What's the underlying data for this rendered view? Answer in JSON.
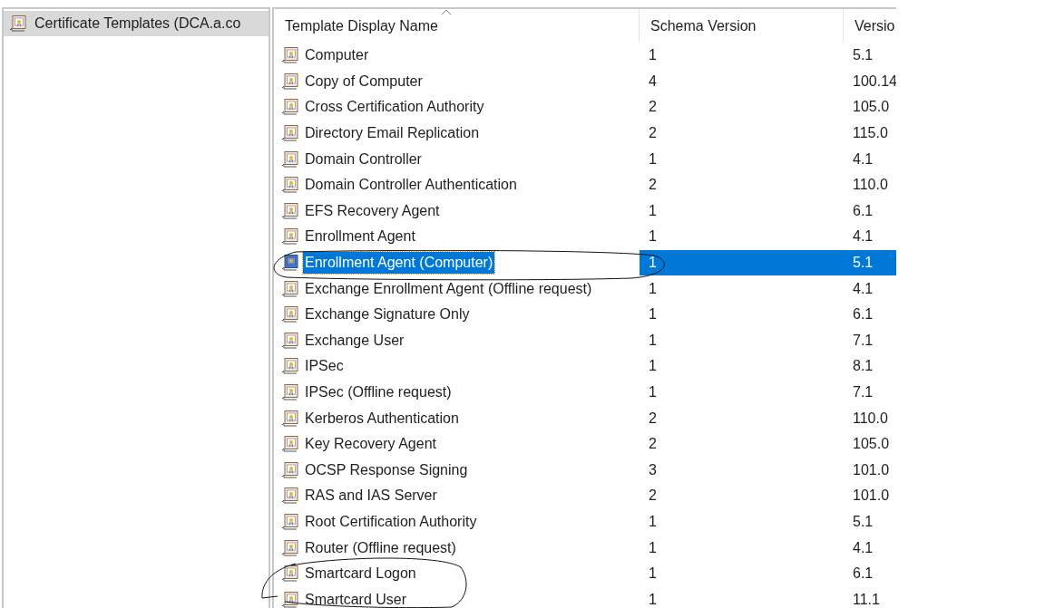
{
  "tree": {
    "items": [
      {
        "label": "Certificate Templates (DCA.a.co",
        "selected": true
      }
    ]
  },
  "table": {
    "columns": [
      {
        "label": "Template Display Name",
        "sorted": true
      },
      {
        "label": "Schema Version",
        "sorted": false
      },
      {
        "label": "Versio",
        "sorted": false
      }
    ],
    "rows": [
      {
        "name": "Computer",
        "schema": "1",
        "version": "5.1",
        "selected": false
      },
      {
        "name": "Copy of Computer",
        "schema": "4",
        "version": "100.14",
        "selected": false
      },
      {
        "name": "Cross Certification Authority",
        "schema": "2",
        "version": "105.0",
        "selected": false
      },
      {
        "name": "Directory Email Replication",
        "schema": "2",
        "version": "115.0",
        "selected": false
      },
      {
        "name": "Domain Controller",
        "schema": "1",
        "version": "4.1",
        "selected": false
      },
      {
        "name": "Domain Controller Authentication",
        "schema": "2",
        "version": "110.0",
        "selected": false
      },
      {
        "name": "EFS Recovery Agent",
        "schema": "1",
        "version": "6.1",
        "selected": false
      },
      {
        "name": "Enrollment Agent",
        "schema": "1",
        "version": "4.1",
        "selected": false
      },
      {
        "name": "Enrollment Agent (Computer)",
        "schema": "1",
        "version": "5.1",
        "selected": true
      },
      {
        "name": "Exchange Enrollment Agent (Offline request)",
        "schema": "1",
        "version": "4.1",
        "selected": false
      },
      {
        "name": "Exchange Signature Only",
        "schema": "1",
        "version": "6.1",
        "selected": false
      },
      {
        "name": "Exchange User",
        "schema": "1",
        "version": "7.1",
        "selected": false
      },
      {
        "name": "IPSec",
        "schema": "1",
        "version": "8.1",
        "selected": false
      },
      {
        "name": "IPSec (Offline request)",
        "schema": "1",
        "version": "7.1",
        "selected": false
      },
      {
        "name": "Kerberos Authentication",
        "schema": "2",
        "version": "110.0",
        "selected": false
      },
      {
        "name": "Key Recovery Agent",
        "schema": "2",
        "version": "105.0",
        "selected": false
      },
      {
        "name": "OCSP Response Signing",
        "schema": "3",
        "version": "101.0",
        "selected": false
      },
      {
        "name": "RAS and IAS Server",
        "schema": "2",
        "version": "101.0",
        "selected": false
      },
      {
        "name": "Root Certification Authority",
        "schema": "1",
        "version": "5.1",
        "selected": false
      },
      {
        "name": "Router (Offline request)",
        "schema": "1",
        "version": "4.1",
        "selected": false
      },
      {
        "name": "Smartcard Logon",
        "schema": "1",
        "version": "6.1",
        "selected": false
      },
      {
        "name": "Smartcard User",
        "schema": "1",
        "version": "11.1",
        "selected": false
      }
    ]
  }
}
